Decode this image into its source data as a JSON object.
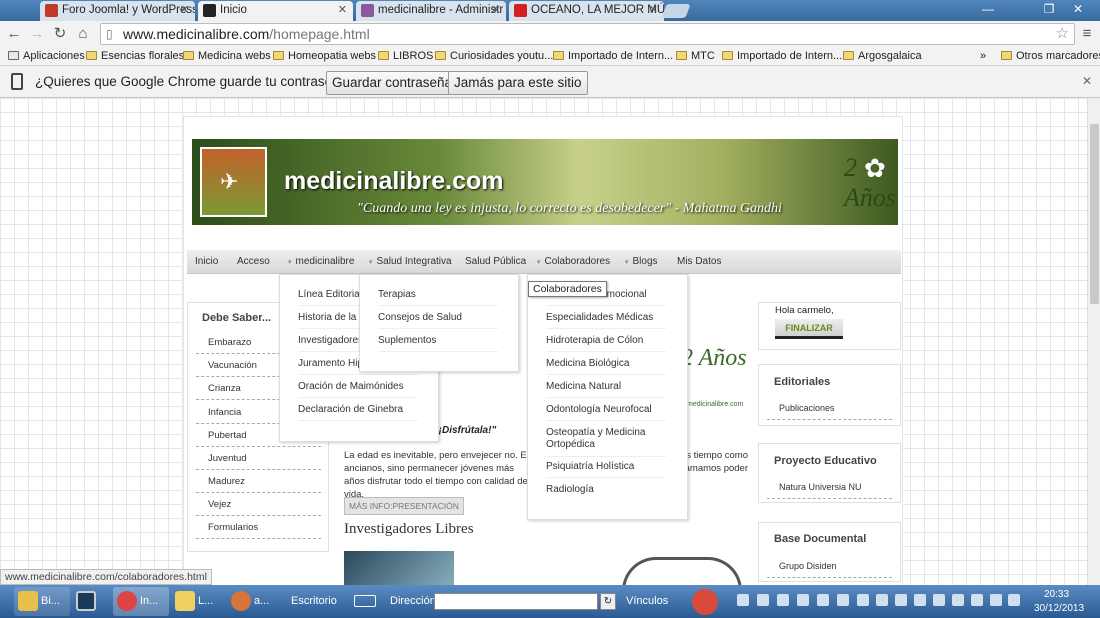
{
  "browser": {
    "tabs": [
      {
        "label": "Foro Joomla! y WordPress",
        "active": false
      },
      {
        "label": "Inicio",
        "active": true
      },
      {
        "label": "medicinalibre - Administr",
        "active": false
      },
      {
        "label": "OCEANO, LA MEJOR MÚS",
        "active": false
      }
    ],
    "url_host": "www.medicinalibre.com",
    "url_path": "/homepage.html",
    "bookmarks": [
      "Aplicaciones",
      "Esencias florales",
      "Medicina webs",
      "Homeopatia webs",
      "LIBROS",
      "Curiosidades youtu...",
      "Importado de Intern...",
      "MTC",
      "Importado de Intern...",
      "Argosgalaica",
      "»",
      "Otros marcadores"
    ],
    "infobar": {
      "question": "¿Quieres que Google Chrome guarde tu contraseña?",
      "save_label": "Guardar contraseña",
      "never_label": "Jamás para este sitio"
    },
    "status_url": "www.medicinalibre.com/colaboradores.html"
  },
  "site": {
    "name": "medicinalibre.com",
    "motto": "\"Cuando una ley es injusta, lo correcto es desobedecer\" - Mahatma Gandhi",
    "years_badge": "2 Años",
    "nav": [
      "Inicio",
      "Acceso",
      "medicinalibre",
      "Salud Integrativa",
      "Salud Pública",
      "Colaboradores",
      "Blogs",
      "Mis Datos"
    ],
    "dropdown_medicinalibre": [
      "Línea Editorial",
      "Historia de la Me",
      "Investigadores L",
      "Juramento Hipo",
      "Oración de Maimónides",
      "Declaración de Ginebra"
    ],
    "dropdown_salud": [
      "Terapias",
      "Consejos de Salud",
      "Suplementos"
    ],
    "dropdown_colaboradores": [
      "Colaboradores",
      "Emocional",
      "Especialidades Médicas",
      "Hidroterapia de Cólon",
      "Medicina Biológica",
      "Medicina Natural",
      "Odontología Neurofocal",
      "Osteopatía y Medicina Ortopédica",
      "Psiquiatría Holística",
      "Radiología"
    ],
    "tooltip": "Colaboradores",
    "left_box": {
      "title": "Debe Saber...",
      "items": [
        "Embarazo",
        "Vacunación",
        "Crianza",
        "Infancia",
        "Pubertad",
        "Juventud",
        "Madurez",
        "Vejez",
        "Formularios"
      ]
    },
    "article": {
      "quote": "ante; ¡Disfrútala!\"",
      "body": "La edad es inevitable, pero envejecer no. E ancianos, sino permanecer jóvenes más años disfrutar todo el tiempo con calidad de vida.",
      "body_right": "s tiempo como amamos poder",
      "more_label": "MÁS INFO:PRESENTACIÓN",
      "heading": "Investigadores Libres"
    },
    "right": {
      "greeting": "Hola carmelo,",
      "logout_label": "FINALIZAR",
      "editoriales_title": "Editoriales",
      "editoriales_item": "Publicaciones",
      "proyecto_title": "Proyecto Educativo",
      "proyecto_item": "Natura Universia NU",
      "base_title": "Base Documental",
      "base_item": "Grupo Disiden"
    },
    "badge_2anos": "2 Años",
    "badge_site": "medicinalibre.com"
  },
  "taskbar": {
    "apps": [
      "Bi...",
      "In...",
      "L...",
      "a..."
    ],
    "escritorio": "Escritorio",
    "direccion": "Dirección",
    "vinculos": "Vínculos",
    "time": "20:33",
    "date": "30/12/2013"
  },
  "colors": {
    "chrome_blue": "#3b6ea0",
    "taskbar": "#2b5a92",
    "banner_green": "#6a8a3a"
  }
}
